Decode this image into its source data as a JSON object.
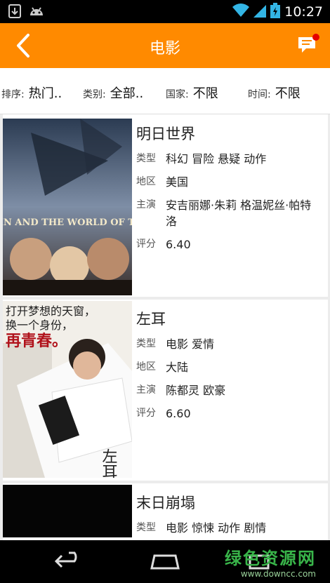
{
  "status_bar": {
    "time": "10:27"
  },
  "app_bar": {
    "title": "电影"
  },
  "filters": [
    {
      "label": "排序:",
      "value": "热门.."
    },
    {
      "label": "类别:",
      "value": "全部.."
    },
    {
      "label": "国家:",
      "value": "不限"
    },
    {
      "label": "时间:",
      "value": "不限"
    }
  ],
  "movies": [
    {
      "title": "明日世界",
      "type_label": "类型",
      "type": "科幻 冒险 悬疑 动作",
      "region_label": "地区",
      "region": "美国",
      "cast_label": "主演",
      "cast": "安吉丽娜·朱莉 格温妮丝·帕特洛",
      "rating_label": "评分",
      "rating": "6.40",
      "poster_text": "SKY CAPTAIN AND THE WORLD OF TOMORROW"
    },
    {
      "title": "左耳",
      "type_label": "类型",
      "type": "电影 爱情",
      "region_label": "地区",
      "region": "大陆",
      "cast_label": "主演",
      "cast": "陈都灵 欧豪",
      "rating_label": "评分",
      "rating": "6.60",
      "poster_text_1": "打开梦想的天窗，",
      "poster_text_2": "换一个身份，",
      "poster_text_3": "再青春。",
      "poster_title": "左耳"
    },
    {
      "title": "末日崩塌",
      "type_label": "类型",
      "type": "电影 惊悚 动作 剧情"
    }
  ],
  "watermark": {
    "text": "绿色资源网",
    "url": "www.downcc.com"
  }
}
